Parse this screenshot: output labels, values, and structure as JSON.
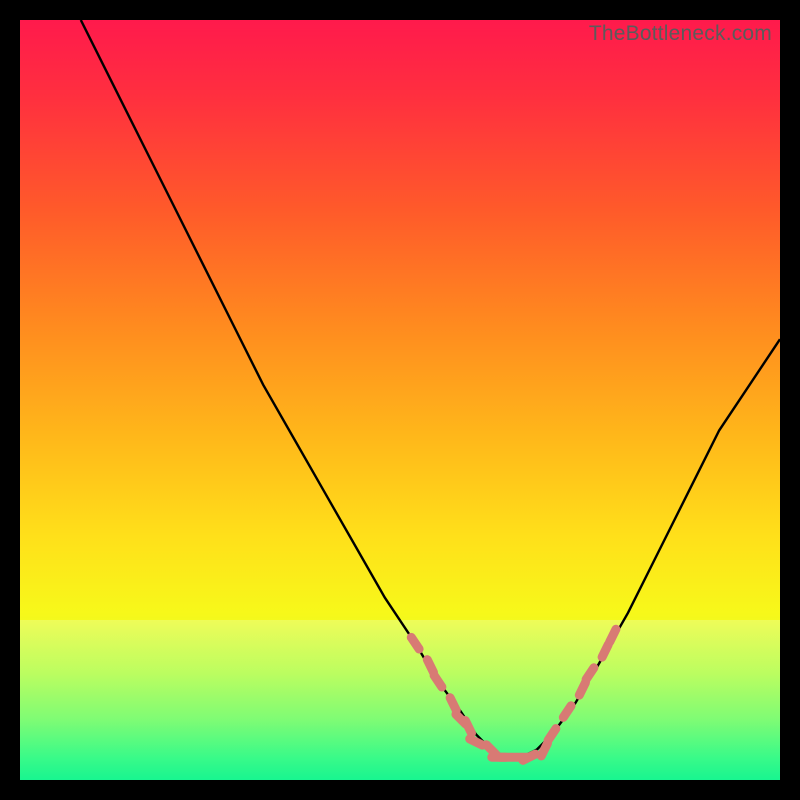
{
  "watermark": "TheBottleneck.com",
  "colors": {
    "gradient_stops": [
      {
        "offset": 0.0,
        "color": "#ff1a4c"
      },
      {
        "offset": 0.1,
        "color": "#ff2f3f"
      },
      {
        "offset": 0.25,
        "color": "#ff5a2a"
      },
      {
        "offset": 0.4,
        "color": "#ff8a1f"
      },
      {
        "offset": 0.55,
        "color": "#ffb81a"
      },
      {
        "offset": 0.68,
        "color": "#ffe01a"
      },
      {
        "offset": 0.78,
        "color": "#f7f81a"
      },
      {
        "offset": 0.86,
        "color": "#d8ff2a"
      },
      {
        "offset": 0.92,
        "color": "#9cff55"
      },
      {
        "offset": 0.97,
        "color": "#40ff80"
      },
      {
        "offset": 1.0,
        "color": "#18f590"
      }
    ],
    "bottom_band_top": "#eaff8a",
    "bottom_band_bottom": "#18f590",
    "curve": "#000000",
    "marker_fill": "#d87a74",
    "marker_stroke": "#c96a64"
  },
  "chart_data": {
    "type": "line",
    "title": "",
    "xlabel": "",
    "ylabel": "",
    "xlim": [
      0,
      100
    ],
    "ylim": [
      0,
      100
    ],
    "series": [
      {
        "name": "bottleneck-curve",
        "x": [
          8,
          12,
          16,
          20,
          24,
          28,
          32,
          36,
          40,
          44,
          48,
          52,
          55,
          58,
          60,
          62,
          64,
          66,
          68,
          70,
          73,
          76,
          80,
          84,
          88,
          92,
          96,
          100
        ],
        "y": [
          100,
          92,
          84,
          76,
          68,
          60,
          52,
          45,
          38,
          31,
          24,
          18,
          13,
          9,
          6,
          4,
          3,
          3,
          4,
          6,
          10,
          15,
          22,
          30,
          38,
          46,
          52,
          58
        ]
      }
    ],
    "markers": {
      "name": "highlighted-segments",
      "points": [
        {
          "x": 52,
          "y": 18
        },
        {
          "x": 54,
          "y": 15
        },
        {
          "x": 55,
          "y": 13
        },
        {
          "x": 57,
          "y": 10
        },
        {
          "x": 58,
          "y": 8
        },
        {
          "x": 59,
          "y": 7
        },
        {
          "x": 60,
          "y": 5
        },
        {
          "x": 62,
          "y": 4
        },
        {
          "x": 63,
          "y": 3
        },
        {
          "x": 64,
          "y": 3
        },
        {
          "x": 66,
          "y": 3
        },
        {
          "x": 67,
          "y": 3
        },
        {
          "x": 69,
          "y": 4
        },
        {
          "x": 70,
          "y": 6
        },
        {
          "x": 72,
          "y": 9
        },
        {
          "x": 74,
          "y": 12
        },
        {
          "x": 75,
          "y": 14
        },
        {
          "x": 77,
          "y": 17
        },
        {
          "x": 78,
          "y": 19
        }
      ]
    }
  }
}
